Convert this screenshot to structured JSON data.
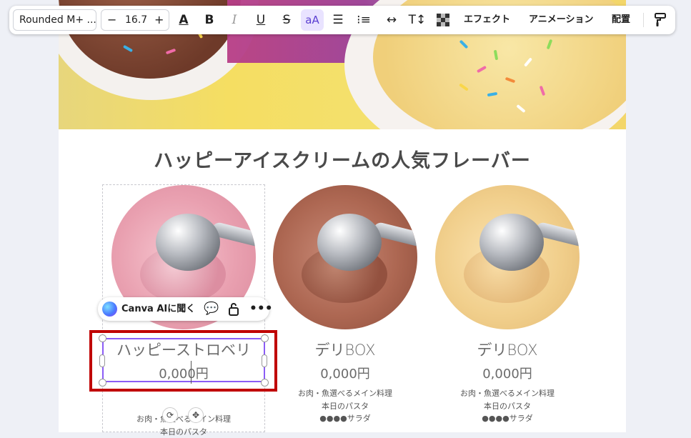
{
  "toolbar": {
    "font_name": "Rounded M+ ...",
    "size_minus": "−",
    "font_size": "16.7",
    "size_plus": "+",
    "effects": "エフェクト",
    "animation": "アニメーション",
    "position": "配置"
  },
  "page": {
    "title": "ハッピーアイスクリームの人気フレーバー"
  },
  "products": [
    {
      "name": "ハッピーストロベリ",
      "price": "0,000円",
      "desc": [
        "お肉・魚選べるメイン料理",
        "本日のパスタ"
      ]
    },
    {
      "name": "デリBOX",
      "price": "0,000円",
      "desc": [
        "お肉・魚選べるメイン料理",
        "本日のパスタ",
        "●●●●サラダ"
      ]
    },
    {
      "name": "デリBOX",
      "price": "0,000円",
      "desc": [
        "お肉・魚選べるメイン料理",
        "本日のパスタ",
        "●●●●サラダ"
      ]
    }
  ],
  "ai_bar": {
    "label": "Canva AIに聞く"
  },
  "colors": {
    "selection": "#8b5cf6",
    "highlight_frame": "#c00000"
  },
  "icons": [
    "text-color-icon",
    "bold-icon",
    "italic-icon",
    "underline-icon",
    "strikethrough-icon",
    "letter-case-icon",
    "align-center-icon",
    "list-icon",
    "letter-spacing-icon",
    "text-direction-icon",
    "transparency-icon",
    "paint-format-icon",
    "comment-add-icon",
    "lock-icon",
    "more-icon",
    "rotate-icon",
    "move-icon"
  ]
}
